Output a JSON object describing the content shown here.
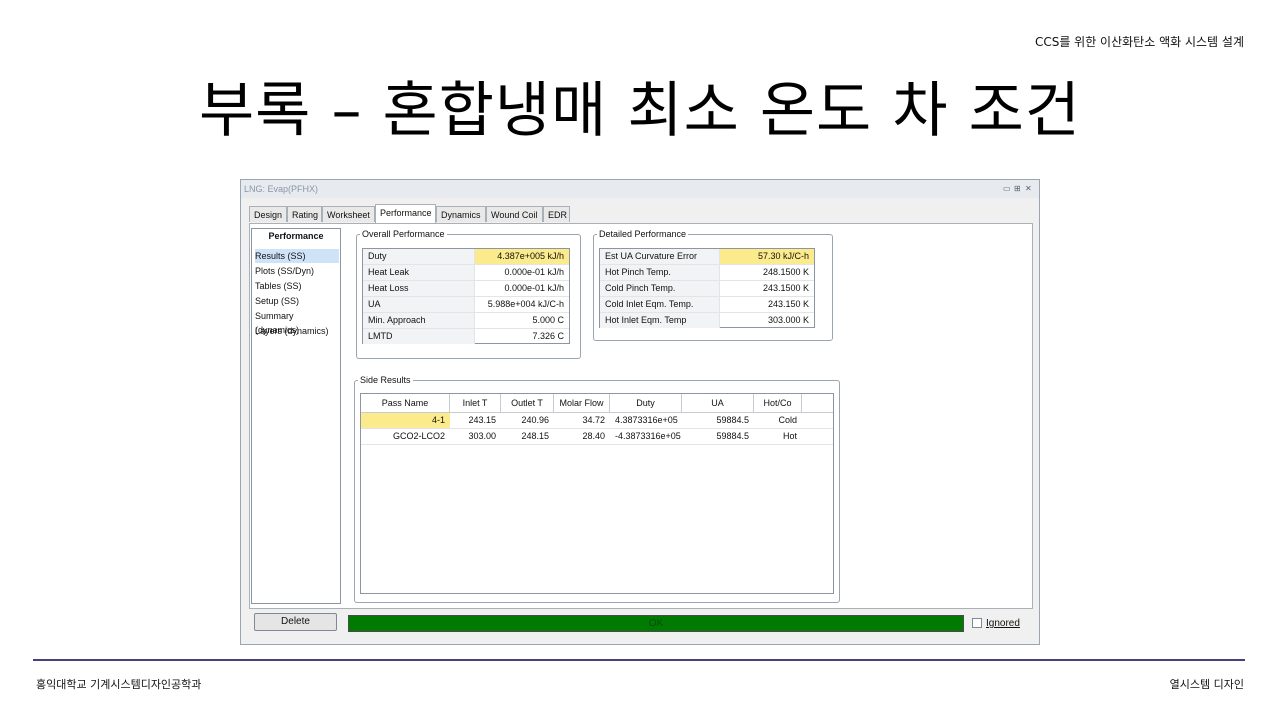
{
  "slide": {
    "header": "CCS를 위한 이산화탄소 액화 시스템 설계",
    "title": "부록 – 혼합냉매 최소 온도 차 조건",
    "footer_left": "홍익대학교 기계시스템디자인공학과",
    "footer_right": "열시스템 디자인"
  },
  "window": {
    "title": "LNG: Evap(PFHX)",
    "tabs": [
      "Design",
      "Rating",
      "Worksheet",
      "Performance",
      "Dynamics",
      "Wound Coil",
      "EDR"
    ],
    "active_tab": "Performance",
    "sidebar": {
      "heading": "Performance",
      "items": [
        "Results (SS)",
        "Plots (SS/Dyn)",
        "Tables (SS)",
        "Setup (SS)",
        "Summary (dynamics)",
        "Layers (dynamics)"
      ],
      "selected": "Results (SS)"
    },
    "overall": {
      "label": "Overall Performance",
      "rows": [
        {
          "name": "Duty",
          "value": "4.387e+005 kJ/h"
        },
        {
          "name": "Heat Leak",
          "value": "0.000e-01 kJ/h"
        },
        {
          "name": "Heat Loss",
          "value": "0.000e-01 kJ/h"
        },
        {
          "name": "UA",
          "value": "5.988e+004 kJ/C-h"
        },
        {
          "name": "Min. Approach",
          "value": "5.000 C"
        },
        {
          "name": "LMTD",
          "value": "7.326 C"
        }
      ]
    },
    "detailed": {
      "label": "Detailed Performance",
      "rows": [
        {
          "name": "Est UA Curvature Error",
          "value": "57.30 kJ/C-h"
        },
        {
          "name": "Hot Pinch Temp.",
          "value": "248.1500 K"
        },
        {
          "name": "Cold Pinch Temp.",
          "value": "243.1500 K"
        },
        {
          "name": "Cold Inlet Eqm. Temp.",
          "value": "243.150 K"
        },
        {
          "name": "Hot Inlet Eqm. Temp",
          "value": "303.000 K"
        }
      ]
    },
    "side_results": {
      "label": "Side Results",
      "columns": [
        "Pass Name",
        "Inlet T",
        "Outlet T",
        "Molar Flow",
        "Duty",
        "UA",
        "Hot/Co"
      ],
      "rows": [
        [
          "4-1",
          "243.15",
          "240.96",
          "34.72",
          "4.3873316e+05",
          "59884.5",
          "Cold"
        ],
        [
          "GCO2-LCO2",
          "303.00",
          "248.15",
          "28.40",
          "-4.3873316e+05",
          "59884.5",
          "Hot"
        ]
      ]
    },
    "delete_label": "Delete",
    "status": "OK",
    "ignored_label": "Ignored",
    "colors": {
      "highlight": "#fbeb8c",
      "status_ok": "#007a00"
    }
  }
}
